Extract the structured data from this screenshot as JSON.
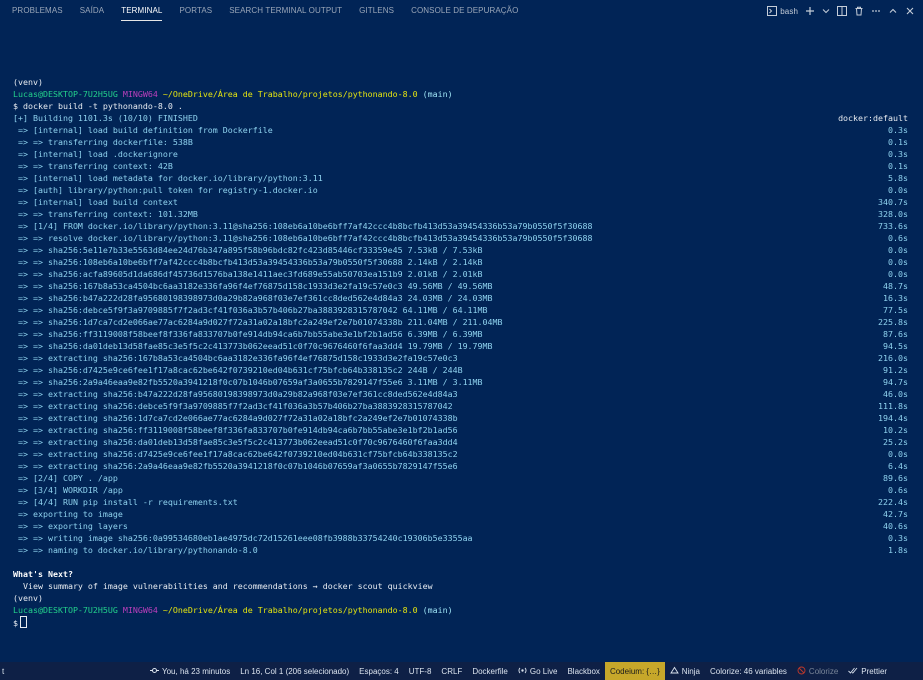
{
  "panel": {
    "tabs": [
      "PROBLEMAS",
      "SAÍDA",
      "TERMINAL",
      "PORTAS",
      "SEARCH TERMINAL OUTPUT",
      "GITLENS",
      "CONSOLE DE DEPURAÇÃO"
    ],
    "active_tab": "TERMINAL",
    "shell": "bash"
  },
  "terminal": {
    "venv1": "(venv)",
    "prompt1": {
      "user": "Lucas@DESKTOP-7U2H5UG",
      "host": "MINGW64",
      "path": "~/OneDrive/Área de Trabalho/projetos/pythonando-8.0",
      "branch": "(main)"
    },
    "command": "$ docker build -t pythonando-8.0 .",
    "build_header": {
      "text": "[+] Building 1101.3s (10/10) FINISHED",
      "right": "docker:default"
    },
    "build_lines": [
      {
        "text": " => [internal] load build definition from Dockerfile",
        "time": "0.3s"
      },
      {
        "text": " => => transferring dockerfile: 538B",
        "time": "0.1s"
      },
      {
        "text": " => [internal] load .dockerignore",
        "time": "0.3s"
      },
      {
        "text": " => => transferring context: 42B",
        "time": "0.1s"
      },
      {
        "text": " => [internal] load metadata for docker.io/library/python:3.11",
        "time": "5.8s"
      },
      {
        "text": " => [auth] library/python:pull token for registry-1.docker.io",
        "time": "0.0s"
      },
      {
        "text": " => [internal] load build context",
        "time": "340.7s"
      },
      {
        "text": " => => transferring context: 101.32MB",
        "time": "328.0s"
      },
      {
        "text": " => [1/4] FROM docker.io/library/python:3.11@sha256:108eb6a10be6bff7af42ccc4b8bcfb413d53a39454336b53a79b0550f5f30688",
        "time": "733.6s"
      },
      {
        "text": " => => resolve docker.io/library/python:3.11@sha256:108eb6a10be6bff7af42ccc4b8bcfb413d53a39454336b53a79b0550f5f30688",
        "time": "0.6s"
      },
      {
        "text": " => => sha256:5e11e7b33e5563d84ee24d76b347a895f58b96bdc82fc423d85446cf33359e45 7.53kB / 7.53kB",
        "time": "0.0s"
      },
      {
        "text": " => => sha256:108eb6a10be6bff7af42ccc4b8bcfb413d53a39454336b53a79b0550f5f30688 2.14kB / 2.14kB",
        "time": "0.0s"
      },
      {
        "text": " => => sha256:acfa89605d1da686df45736d1576ba138e1411aec3fd689e55ab50703ea151b9 2.01kB / 2.01kB",
        "time": "0.0s"
      },
      {
        "text": " => => sha256:167b8a53ca4504bc6aa3182e336fa96f4ef76875d158c1933d3e2fa19c57e0c3 49.56MB / 49.56MB",
        "time": "48.7s"
      },
      {
        "text": " => => sha256:b47a222d28fa95680198398973d0a29b82a968f03e7ef361cc8ded562e4d84a3 24.03MB / 24.03MB",
        "time": "16.3s"
      },
      {
        "text": " => => sha256:debce5f9f3a9709885f7f2ad3cf41f036a3b57b406b27ba3883928315787042 64.11MB / 64.11MB",
        "time": "77.5s"
      },
      {
        "text": " => => sha256:1d7ca7cd2e066ae77ac6284a9d027f72a31a02a18bfc2a249ef2e7b01074338b 211.04MB / 211.04MB",
        "time": "225.8s"
      },
      {
        "text": " => => sha256:ff3119008f58beef8f336fa833707b0fe914db94ca6b7bb55abe3e1bf2b1ad56 6.39MB / 6.39MB",
        "time": "87.6s"
      },
      {
        "text": " => => sha256:da01deb13d58fae85c3e5f5c2c413773b062eead51c0f70c9676460f6faa3dd4 19.79MB / 19.79MB",
        "time": "94.5s"
      },
      {
        "text": " => => extracting sha256:167b8a53ca4504bc6aa3182e336fa96f4ef76875d158c1933d3e2fa19c57e0c3",
        "time": "216.0s"
      },
      {
        "text": " => => sha256:d7425e9ce6fee1f17a8cac62be642f0739210ed04b631cf75bfcb64b338135c2 244B / 244B",
        "time": "91.2s"
      },
      {
        "text": " => => sha256:2a9a46eaa9e82fb5520a3941218f0c07b1046b07659af3a0655b7829147f55e6 3.11MB / 3.11MB",
        "time": "94.7s"
      },
      {
        "text": " => => extracting sha256:b47a222d28fa95680198398973d0a29b82a968f03e7ef361cc8ded562e4d84a3",
        "time": "46.0s"
      },
      {
        "text": " => => extracting sha256:debce5f9f3a9709885f7f2ad3cf41f036a3b57b406b27ba3883928315787042",
        "time": "111.8s"
      },
      {
        "text": " => => extracting sha256:1d7ca7cd2e066ae77ac6284a9d027f72a31a02a18bfc2a249ef2e7b01074338b",
        "time": "194.4s"
      },
      {
        "text": " => => extracting sha256:ff3119008f58beef8f336fa833707b0fe914db94ca6b7bb55abe3e1bf2b1ad56",
        "time": "10.2s"
      },
      {
        "text": " => => extracting sha256:da01deb13d58fae85c3e5f5c2c413773b062eead51c0f70c9676460f6faa3dd4",
        "time": "25.2s"
      },
      {
        "text": " => => extracting sha256:d7425e9ce6fee1f17a8cac62be642f0739210ed04b631cf75bfcb64b338135c2",
        "time": "0.0s"
      },
      {
        "text": " => => extracting sha256:2a9a46eaa9e82fb5520a3941218f0c07b1046b07659af3a0655b7829147f55e6",
        "time": "6.4s"
      },
      {
        "text": " => [2/4] COPY . /app",
        "time": "89.6s"
      },
      {
        "text": " => [3/4] WORKDIR /app",
        "time": "0.6s"
      },
      {
        "text": " => [4/4] RUN pip install -r requirements.txt",
        "time": "222.4s"
      },
      {
        "text": " => exporting to image",
        "time": "42.7s"
      },
      {
        "text": " => => exporting layers",
        "time": "40.6s"
      },
      {
        "text": " => => writing image sha256:0a99534680eb1ae4975dc72d15261eee08fb3988b33754240c19306b5e3355aa",
        "time": "0.3s"
      },
      {
        "text": " => => naming to docker.io/library/pythonando-8.0",
        "time": "1.8s"
      }
    ],
    "whats_next_title": "What's Next?",
    "whats_next_text": "  View summary of image vulnerabilities and recommendations → docker scout quickview",
    "venv2": "(venv)",
    "prompt2": {
      "user": "Lucas@DESKTOP-7U2H5UG",
      "host": "MINGW64",
      "path": "~/OneDrive/Área de Trabalho/projetos/pythonando-8.0",
      "branch": "(main)"
    },
    "final_prompt": "$"
  },
  "statusbar": {
    "left": "t",
    "items": [
      {
        "name": "git-blame",
        "label": "You, há 23 minutos"
      },
      {
        "name": "cursor-position",
        "label": "Ln 16, Col 1 (206 selecionado)"
      },
      {
        "name": "indentation",
        "label": "Espaços: 4"
      },
      {
        "name": "encoding",
        "label": "UTF-8"
      },
      {
        "name": "line-ending",
        "label": "CRLF"
      },
      {
        "name": "language-mode",
        "label": "Dockerfile"
      },
      {
        "name": "go-live",
        "label": "Go Live"
      },
      {
        "name": "blackbox",
        "label": "Blackbox"
      },
      {
        "name": "codeium",
        "label": "Codeium: {…}"
      },
      {
        "name": "ninja",
        "label": "Ninja"
      },
      {
        "name": "colorize-vars",
        "label": "Colorize: 46 variables"
      },
      {
        "name": "colorize",
        "label": "Colorize"
      },
      {
        "name": "prettier",
        "label": "Prettier"
      }
    ]
  }
}
